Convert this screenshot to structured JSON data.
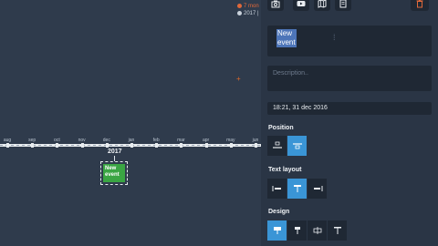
{
  "canvas": {
    "legend": [
      {
        "text": "7 mon",
        "color": "#e0683a"
      },
      {
        "text": "2017 |",
        "color": "#c9d1db"
      }
    ],
    "months": [
      "aug",
      "sep",
      "oct",
      "nov",
      "dec",
      "jan",
      "feb",
      "mar",
      "apr",
      "may",
      "jun"
    ],
    "year": "2017",
    "event": {
      "line1": "New",
      "line2": "event"
    }
  },
  "toolbar": {
    "icons": [
      "camera-icon",
      "youtube-icon",
      "map-icon",
      "document-icon"
    ],
    "delete_icon": "trash-icon"
  },
  "editor": {
    "title_line1": "New",
    "title_line2": "event",
    "description_placeholder": "Description..",
    "datetime": "18:21, 31 dec 2016",
    "position_label": "Position",
    "text_layout_label": "Text layout",
    "design_label": "Design",
    "accent_color": "#3a95d6"
  }
}
